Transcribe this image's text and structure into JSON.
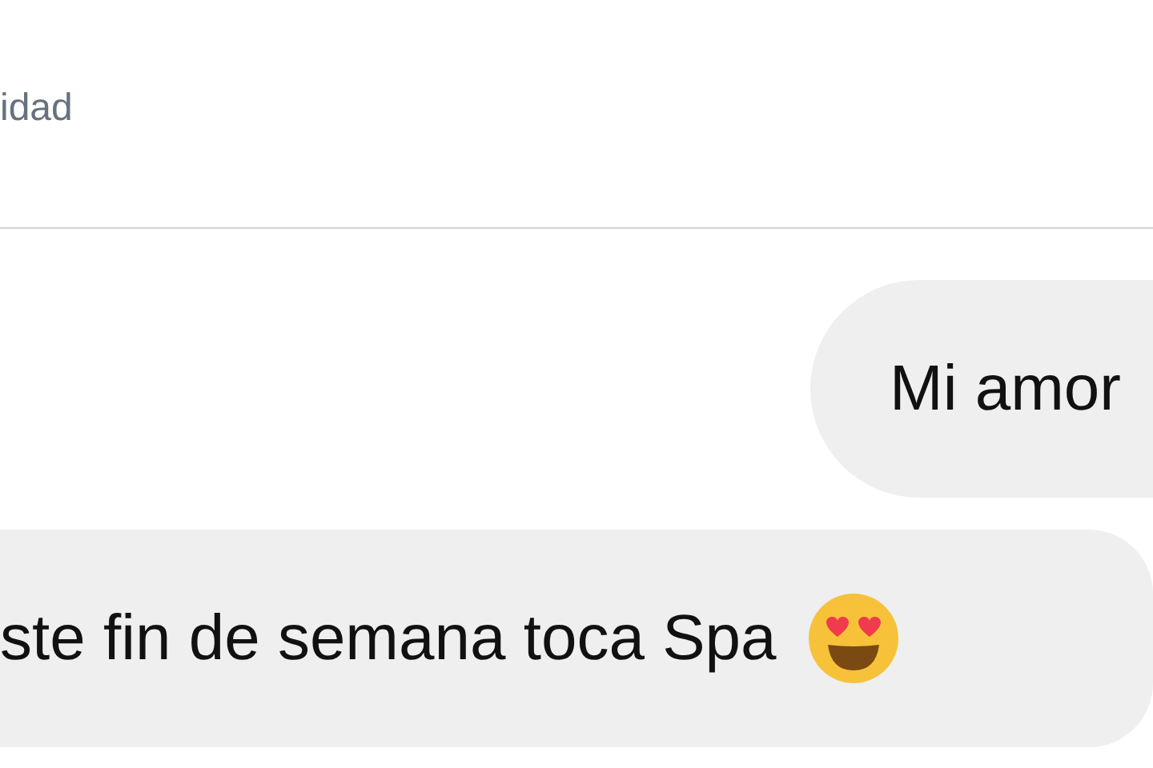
{
  "header": {
    "subtitle": "idad"
  },
  "messages": [
    {
      "kind": "outgoing",
      "text": "Mi amor",
      "emoji": false
    },
    {
      "kind": "incoming",
      "text": "ste fin de semana toca Spa",
      "emoji": true
    }
  ]
}
